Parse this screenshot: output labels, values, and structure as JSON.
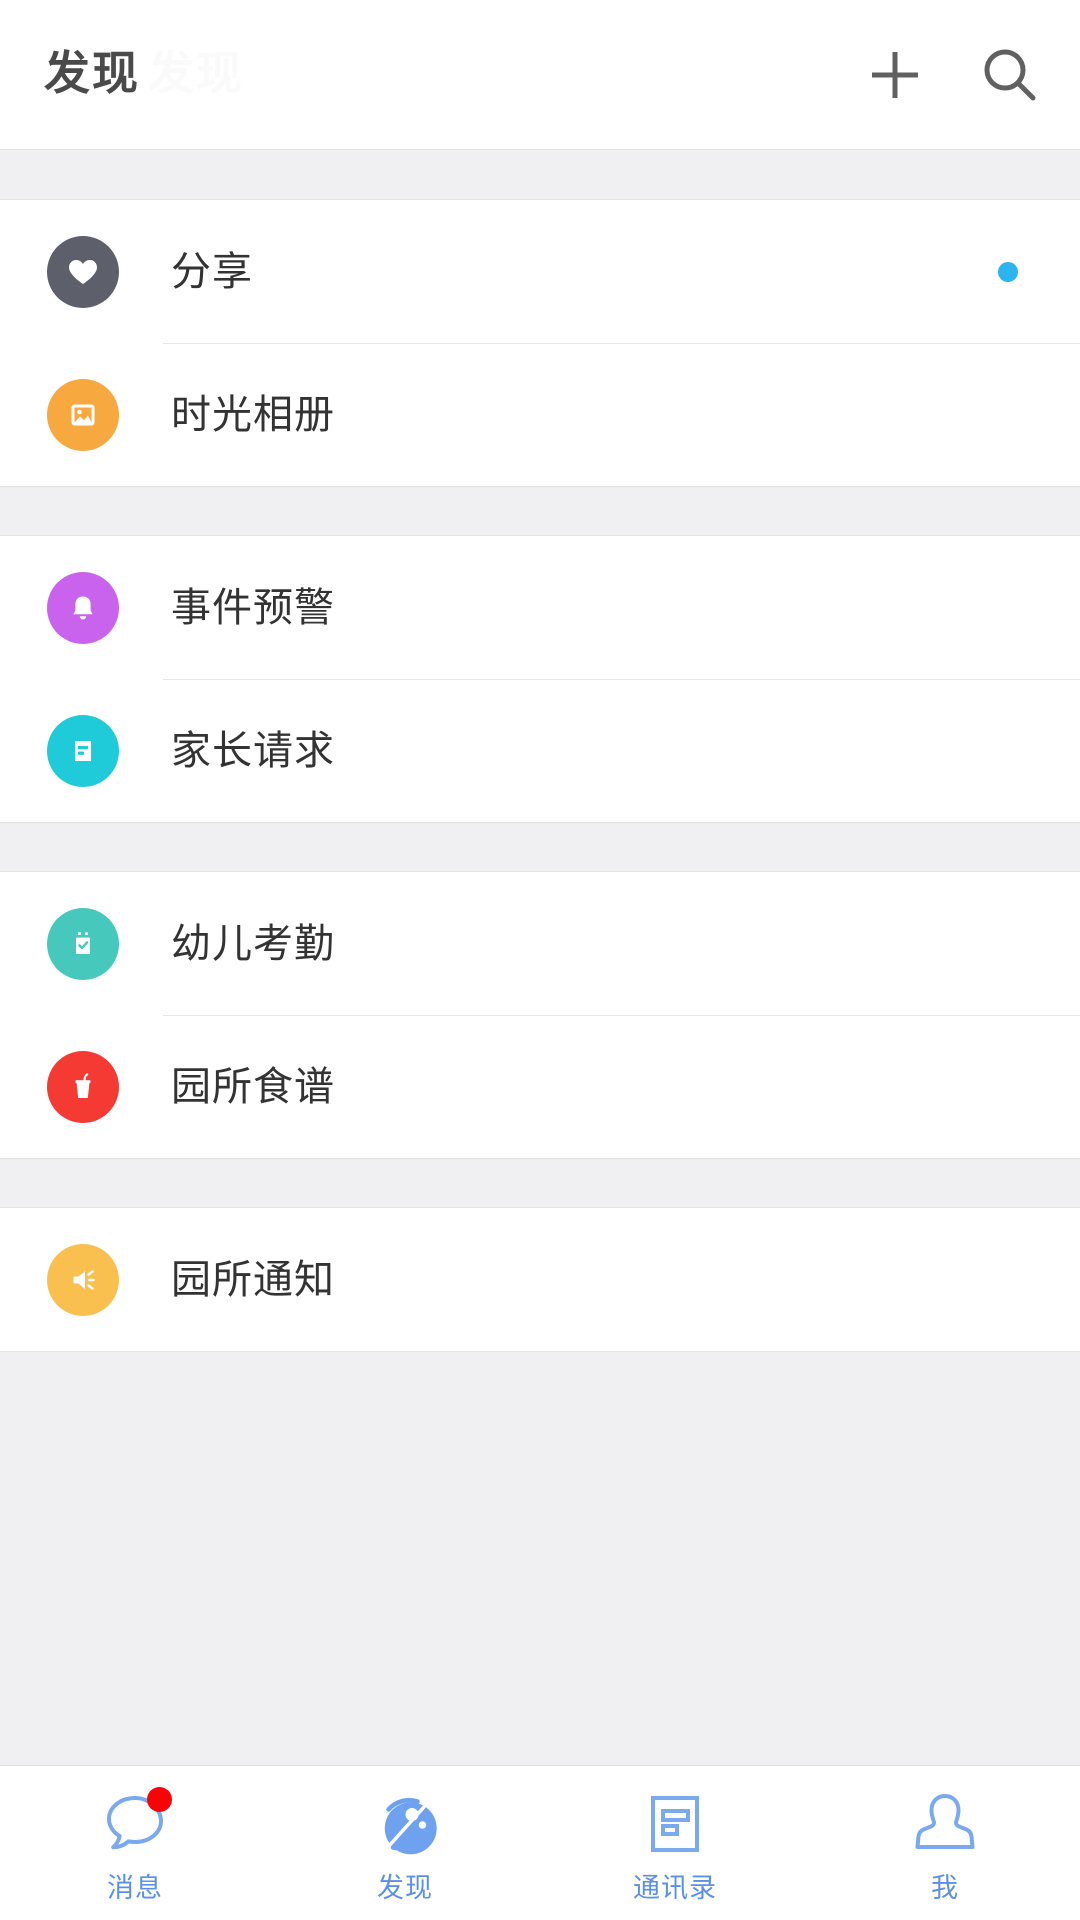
{
  "header": {
    "title": "发现",
    "watermark": "发现",
    "add_icon": "plus-icon",
    "search_icon": "search-icon"
  },
  "colors": {
    "share": "#5d5f6b",
    "album": "#f7a93f",
    "alert": "#c962ec",
    "request": "#1fcbd8",
    "attendance": "#46c8bd",
    "menu": "#f43a33",
    "notice": "#f9bf4f",
    "blue_dot": "#2cb4ee",
    "red_dot": "#f90404",
    "tab_blue": "#5b90e8",
    "page_bg": "#f0f0f2",
    "row_bg": "#ffffff",
    "label": "#333333",
    "title": "#4a4a4a"
  },
  "sections": [
    {
      "rows": [
        {
          "label": "分享",
          "icon": "heart-icon",
          "color_key": "share",
          "badge": "dot"
        },
        {
          "label": "时光相册",
          "icon": "photo-icon",
          "color_key": "album",
          "badge": ""
        }
      ]
    },
    {
      "rows": [
        {
          "label": "事件预警",
          "icon": "bell-icon",
          "color_key": "alert",
          "badge": ""
        },
        {
          "label": "家长请求",
          "icon": "document-icon",
          "color_key": "request",
          "badge": ""
        }
      ]
    },
    {
      "rows": [
        {
          "label": "幼儿考勤",
          "icon": "clipboard-check-icon",
          "color_key": "attendance",
          "badge": ""
        },
        {
          "label": "园所食谱",
          "icon": "drink-cup-icon",
          "color_key": "menu",
          "badge": ""
        }
      ]
    },
    {
      "rows": [
        {
          "label": "园所通知",
          "icon": "speaker-icon",
          "color_key": "notice",
          "badge": ""
        }
      ]
    }
  ],
  "tabbar": {
    "items": [
      {
        "label": "消息",
        "icon": "chat-bubble-icon",
        "active": false,
        "badge": "dot"
      },
      {
        "label": "发现",
        "icon": "compass-icon",
        "active": true,
        "badge": ""
      },
      {
        "label": "通讯录",
        "icon": "contacts-icon",
        "active": false,
        "badge": ""
      },
      {
        "label": "我",
        "icon": "person-icon",
        "active": false,
        "badge": ""
      }
    ]
  }
}
